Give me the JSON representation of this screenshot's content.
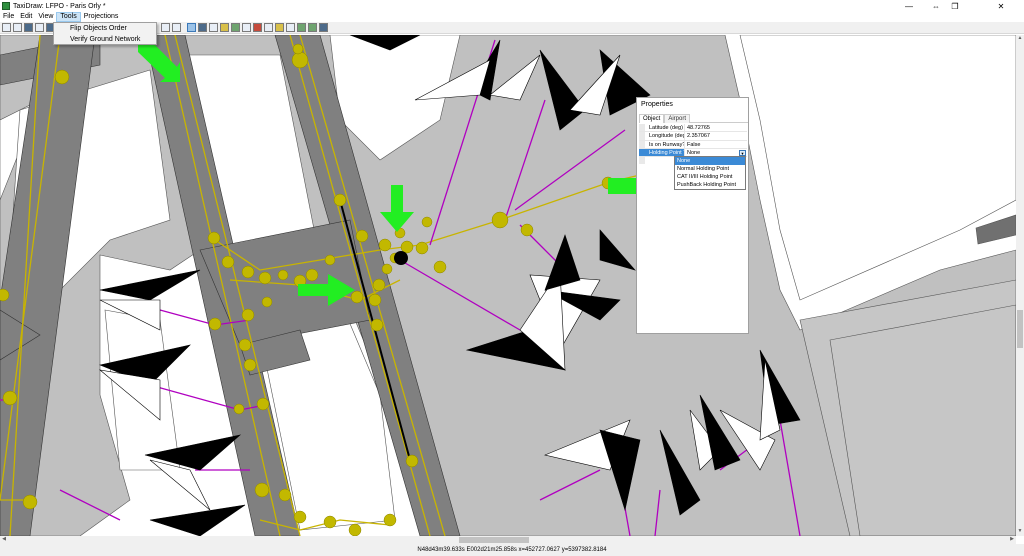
{
  "window": {
    "title": "TaxiDraw: LFPO - Paris Orly *",
    "controls": {
      "minimize": "—",
      "maximize": "❐",
      "close": "✕",
      "extra": "⇔"
    }
  },
  "menu": {
    "items": [
      "File",
      "Edit",
      "View",
      "Tools",
      "Projections"
    ],
    "active": "Tools"
  },
  "tools_menu": {
    "items": [
      "Flip Objects Order",
      "Verify Ground Network"
    ]
  },
  "properties": {
    "title": "Properties",
    "tabs": [
      "Object",
      "Airport"
    ],
    "active_tab": "Object",
    "rows": [
      {
        "key": "Latitude (deg)",
        "value": "48.72765"
      },
      {
        "key": "Longitude (deg)",
        "value": "2.357067"
      },
      {
        "key": "Is on Runway?",
        "value": "False"
      },
      {
        "key": "Holding Point Type",
        "value": "None"
      }
    ],
    "holding_point_options": [
      "None",
      "Normal Holding Point",
      "CAT II/III Holding Point",
      "PushBack Holding Point"
    ],
    "selected_option": "None"
  },
  "status": {
    "coordinates": "N48d43m39.633s E002d21m25.858s x=452727.0627 y=5397382.8184"
  },
  "colors": {
    "taxiway": "#808080",
    "apron": "#c0c0c0",
    "centerline": "#c8b400",
    "node": "#c2b800",
    "link": "#b000c0",
    "arrow": "#22ee22",
    "selection": "#3b8ad6"
  }
}
